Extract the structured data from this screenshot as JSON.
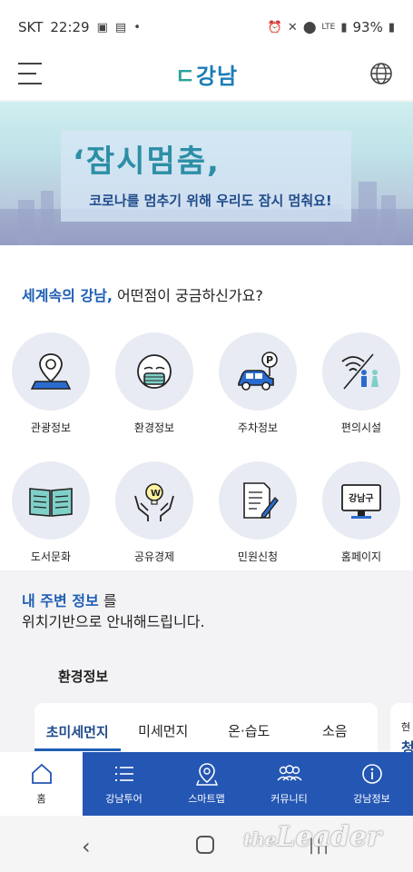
{
  "status_bar": {
    "carrier": "SKT",
    "time": "22:29",
    "network": "LTE",
    "battery": "93%"
  },
  "header": {
    "logo_mark": "ㄷ",
    "logo_text": "강남"
  },
  "banner": {
    "title": "‘잠시멈춤,",
    "subtitle": "코로나를 멈추기 위해 우리도 잠시 멈춰요!"
  },
  "intro": {
    "highlight": "세계속의 강남,",
    "text": " 어떤점이 궁금하신가요?"
  },
  "services": [
    {
      "label": "관광정보",
      "icon": "map-pin-icon"
    },
    {
      "label": "환경정보",
      "icon": "mask-face-icon"
    },
    {
      "label": "주차정보",
      "icon": "car-parking-icon"
    },
    {
      "label": "편의시설",
      "icon": "wifi-restroom-icon"
    },
    {
      "label": "도서문화",
      "icon": "book-icon"
    },
    {
      "label": "공유경제",
      "icon": "hands-bulb-icon"
    },
    {
      "label": "민원신청",
      "icon": "document-pen-icon"
    },
    {
      "label": "홈페이지",
      "icon": "monitor-icon"
    }
  ],
  "monitor_text": "강남구",
  "nearby": {
    "highlight": "내 주변 정보",
    "text_1": " 를",
    "text_2": "위치기반으로 안내해드립니다."
  },
  "environment": {
    "title": "환경정보",
    "tabs": [
      "초미세먼지",
      "미세먼지",
      "온·습도",
      "소음"
    ],
    "active_tab": 0,
    "next_card_line1": "현",
    "next_card_line2": "청"
  },
  "bottom_nav": [
    {
      "label": "홈",
      "icon": "home-icon"
    },
    {
      "label": "강남투어",
      "icon": "list-icon"
    },
    {
      "label": "스마트맵",
      "icon": "map-marker-icon"
    },
    {
      "label": "커뮤니티",
      "icon": "community-icon"
    },
    {
      "label": "강남정보",
      "icon": "info-icon"
    }
  ],
  "watermark": {
    "small": "the",
    "big": "Leader"
  },
  "colors": {
    "primary": "#2456b3",
    "accent": "#1f5fb4",
    "teal": "#2aa39b"
  }
}
